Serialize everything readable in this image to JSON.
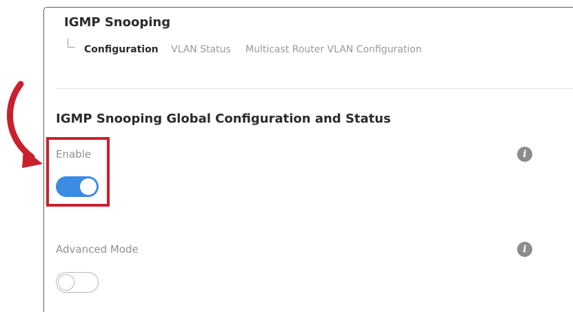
{
  "header": {
    "title": "IGMP Snooping"
  },
  "tabs": [
    {
      "label": "Configuration",
      "active": true
    },
    {
      "label": "VLAN Status",
      "active": false
    },
    {
      "label": "Multicast Router VLAN Configuration",
      "active": false
    }
  ],
  "section": {
    "title": "IGMP Snooping Global Configuration and Status"
  },
  "fields": {
    "enable": {
      "label": "Enable",
      "state": "on",
      "info_icon": "i"
    },
    "advanced_mode": {
      "label": "Advanced Mode",
      "state": "off",
      "info_icon": "i"
    }
  },
  "annotation": {
    "highlight_color": "#c9202d",
    "highlight_target": "enable-toggle"
  },
  "colors": {
    "toggle_on": "#3d8be3",
    "toggle_off_border": "#b8b8b8",
    "info_icon": "#8c8c8c"
  }
}
